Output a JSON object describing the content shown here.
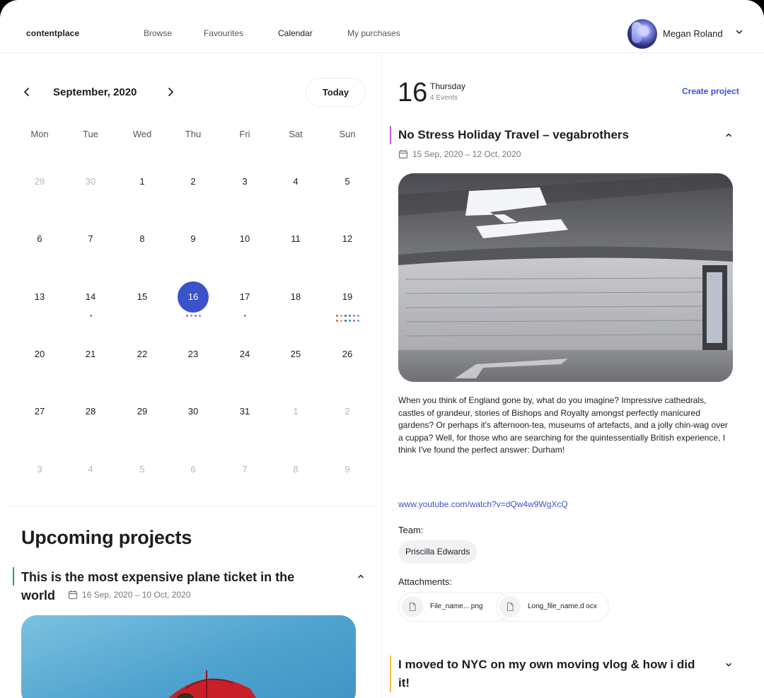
{
  "header": {
    "logo": "contentplace",
    "nav": [
      {
        "label": "Browse",
        "active": false
      },
      {
        "label": "Favourites",
        "active": false
      },
      {
        "label": "Calendar",
        "active": true
      },
      {
        "label": "My purchases",
        "active": false
      }
    ],
    "user_name": "Megan Roland"
  },
  "calendar": {
    "month_label": "September, 2020",
    "today_label": "Today",
    "weekdays": [
      "Mon",
      "Tue",
      "Wed",
      "Thu",
      "Fri",
      "Sat",
      "Sun"
    ],
    "weeks": [
      [
        {
          "d": "29",
          "m": true
        },
        {
          "d": "30",
          "m": true
        },
        {
          "d": "1"
        },
        {
          "d": "2"
        },
        {
          "d": "3"
        },
        {
          "d": "4"
        },
        {
          "d": "5"
        }
      ],
      [
        {
          "d": "6"
        },
        {
          "d": "7"
        },
        {
          "d": "8"
        },
        {
          "d": "9"
        },
        {
          "d": "10"
        },
        {
          "d": "11"
        },
        {
          "d": "12"
        }
      ],
      [
        {
          "d": "13"
        },
        {
          "d": "14",
          "dots": [
            "#d04fd0"
          ]
        },
        {
          "d": "15"
        },
        {
          "d": "16",
          "selected": true,
          "dots": [
            "#d04fd0",
            "#8a8fe0",
            "#d04fd0",
            "#8a8fe0"
          ]
        },
        {
          "d": "17",
          "dots": [
            "#a36be0"
          ]
        },
        {
          "d": "18"
        },
        {
          "d": "19",
          "dots": [
            "#e2574c",
            "#f0a33b",
            "#3a53c9",
            "#2fa35a",
            "#d04fd0",
            "#8a8fe0",
            "#e2574c",
            "#f0a33b",
            "#3a53c9",
            "#2fa35a",
            "#d04fd0",
            "#35b8c9"
          ]
        }
      ],
      [
        {
          "d": "20"
        },
        {
          "d": "21"
        },
        {
          "d": "22"
        },
        {
          "d": "23"
        },
        {
          "d": "24"
        },
        {
          "d": "25"
        },
        {
          "d": "26"
        }
      ],
      [
        {
          "d": "27"
        },
        {
          "d": "28"
        },
        {
          "d": "29"
        },
        {
          "d": "30"
        },
        {
          "d": "31"
        },
        {
          "d": "1",
          "m": true
        },
        {
          "d": "2",
          "m": true
        }
      ],
      [
        {
          "d": "3",
          "m": true
        },
        {
          "d": "4",
          "m": true
        },
        {
          "d": "5",
          "m": true
        },
        {
          "d": "6",
          "m": true
        },
        {
          "d": "7",
          "m": true
        },
        {
          "d": "8",
          "m": true
        },
        {
          "d": "9",
          "m": true
        }
      ]
    ]
  },
  "upcoming": {
    "title": "Upcoming projects",
    "project": {
      "title": "This is the most expensive plane ticket in the world",
      "dates": "16 Sep, 2020 – 10 Oct, 2020",
      "accent_color": "#2fa35a"
    }
  },
  "day_panel": {
    "day_number": "16",
    "weekday": "Thursday",
    "events_count": "4 Events",
    "create_label": "Create project",
    "event": {
      "title": "No Stress Holiday Travel – vegabrothers",
      "dates": "15 Sep, 2020 – 12 Oct, 2020",
      "accent_color": "#c85bd6",
      "description": "When you think of England gone by, what do you imagine? Impressive cathedrals, castles of grandeur, stories of Bishops and Royalty amongst perfectly manicured gardens? Or perhaps it's afternoon-tea, museums of artefacts, and a jolly chin-wag over a cuppa? Well, for those who are searching for the quintessentially British experience, I think I've found the perfect answer: Durham!",
      "link": "www.youtube.com/watch?v=dQw4w9WgXcQ",
      "team_label": "Team:",
      "team_member": "Priscilla Edwards",
      "attachments_label": "Attachments:",
      "attachments": [
        "File_name... png",
        "Long_file_name.d ocx"
      ]
    },
    "next_event": {
      "title": "I moved to NYC on my own moving vlog & how i did it!",
      "accent_color": "#f0c23b"
    }
  },
  "icons": {
    "prev": "chevron-left-icon",
    "next": "chevron-right-icon",
    "collapse": "chevron-up-icon",
    "expand": "chevron-down-icon",
    "calendar": "calendar-icon",
    "file": "file-icon"
  },
  "colors": {
    "accent": "#3a53c9"
  }
}
